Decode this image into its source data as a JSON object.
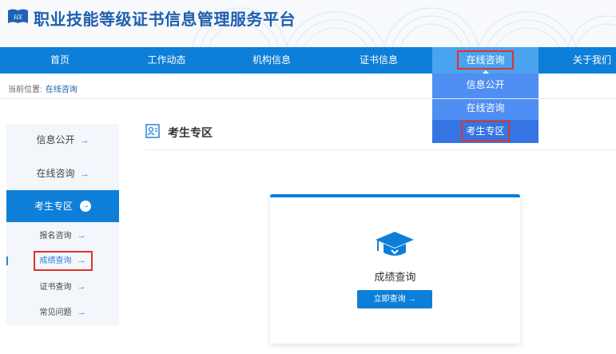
{
  "header": {
    "logo_text": "HX",
    "title": "职业技能等级证书信息管理服务平台"
  },
  "nav": {
    "items": [
      {
        "label": "首页"
      },
      {
        "label": "工作动态"
      },
      {
        "label": "机构信息"
      },
      {
        "label": "证书信息"
      },
      {
        "label": "在线咨询"
      },
      {
        "label": "关于我们"
      }
    ],
    "active_index": 4
  },
  "dropdown": {
    "items": [
      {
        "label": "信息公开"
      },
      {
        "label": "在线咨询"
      },
      {
        "label": "考生专区"
      }
    ]
  },
  "breadcrumb": {
    "prefix": "当前位置:",
    "current": "在线咨询"
  },
  "sidebar": {
    "main_items": [
      {
        "label": "信息公开",
        "arrow": "→"
      },
      {
        "label": "在线咨询",
        "arrow": "→"
      },
      {
        "label": "考生专区",
        "arrow": "→"
      }
    ],
    "sub_items": [
      {
        "label": "报名咨询",
        "arrow": "→"
      },
      {
        "label": "成绩查询",
        "arrow": "→"
      },
      {
        "label": "证书查询",
        "arrow": "→"
      },
      {
        "label": "常见问题",
        "arrow": "→"
      }
    ]
  },
  "section": {
    "title": "考生专区"
  },
  "card": {
    "title": "成绩查询",
    "button_label": "立即查询 →"
  },
  "colors": {
    "nav_blue": "#0d7fd9",
    "dropdown_blue": "#4f8ef2",
    "highlight_red": "#e0322d",
    "title_blue": "#1f5fae"
  }
}
